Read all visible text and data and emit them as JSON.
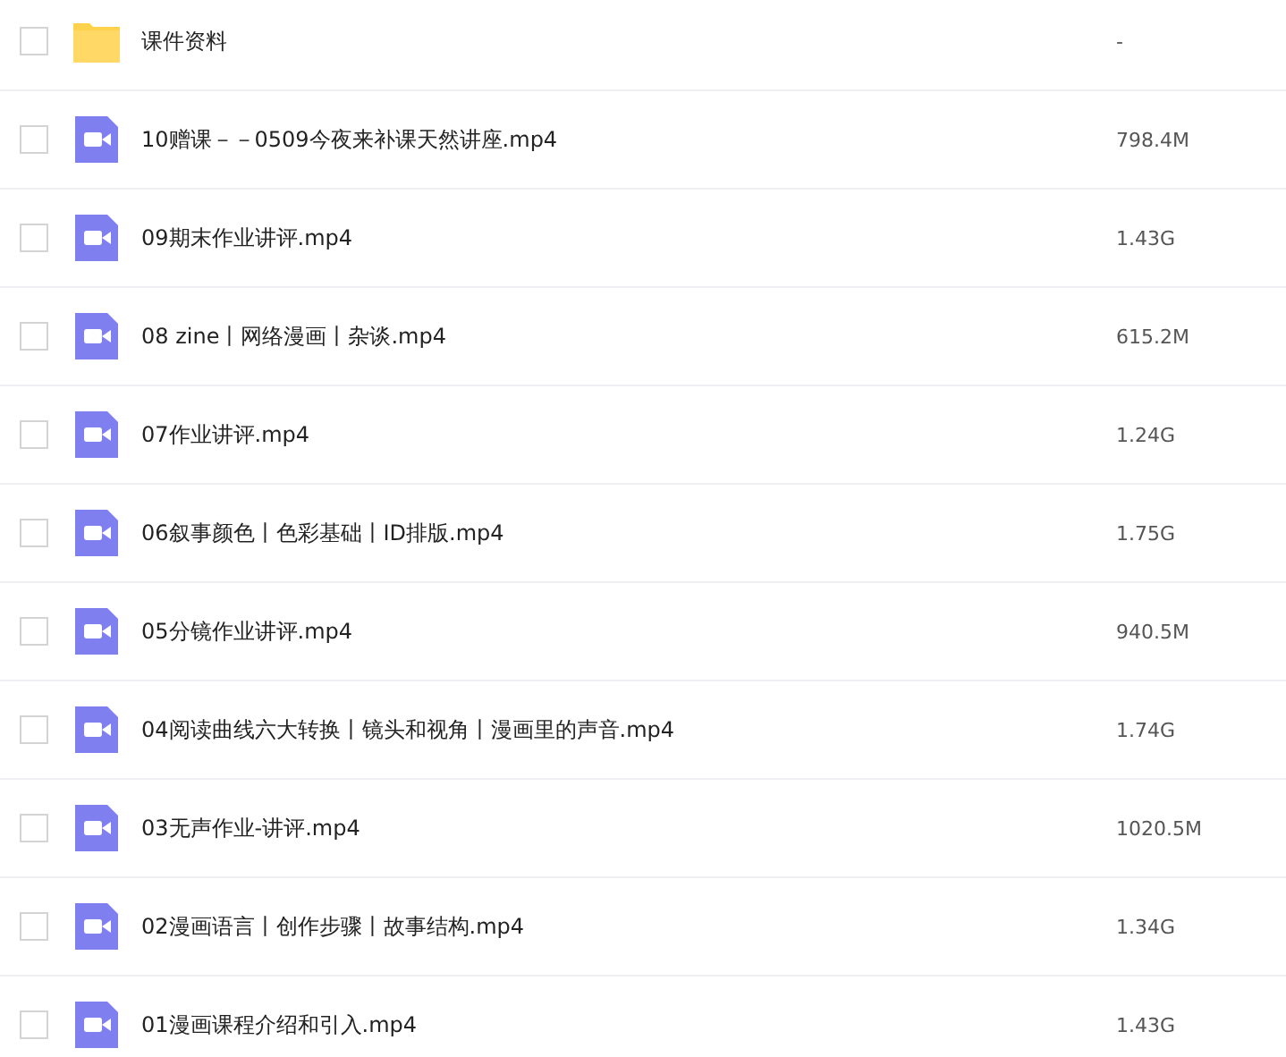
{
  "files": [
    {
      "kind": "folder",
      "name": "课件资料",
      "size": "-",
      "checked": false
    },
    {
      "kind": "video",
      "name": "10赠课－－0509今夜来补课天然讲座.mp4",
      "size": "798.4M",
      "checked": false
    },
    {
      "kind": "video",
      "name": "09期末作业讲评.mp4",
      "size": "1.43G",
      "checked": false
    },
    {
      "kind": "video",
      "name": "08 zine丨网络漫画丨杂谈.mp4",
      "size": "615.2M",
      "checked": false
    },
    {
      "kind": "video",
      "name": "07作业讲评.mp4",
      "size": "1.24G",
      "checked": false
    },
    {
      "kind": "video",
      "name": "06叙事颜色丨色彩基础丨ID排版.mp4",
      "size": "1.75G",
      "checked": false
    },
    {
      "kind": "video",
      "name": "05分镜作业讲评.mp4",
      "size": "940.5M",
      "checked": false
    },
    {
      "kind": "video",
      "name": "04阅读曲线六大转换丨镜头和视角丨漫画里的声音.mp4",
      "size": "1.74G",
      "checked": false
    },
    {
      "kind": "video",
      "name": "03无声作业-讲评.mp4",
      "size": "1020.5M",
      "checked": false
    },
    {
      "kind": "video",
      "name": "02漫画语言丨创作步骤丨故事结构.mp4",
      "size": "1.34G",
      "checked": false
    },
    {
      "kind": "video",
      "name": "01漫画课程介绍和引入.mp4",
      "size": "1.43G",
      "checked": false
    }
  ]
}
